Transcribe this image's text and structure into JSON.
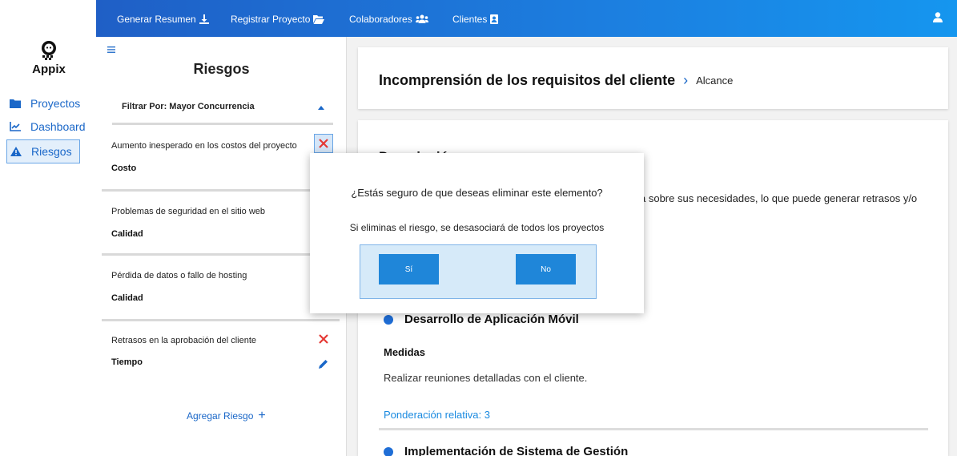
{
  "app": {
    "name": "Appix"
  },
  "sidebar": {
    "items": [
      {
        "label": "Proyectos",
        "icon": "folder-icon"
      },
      {
        "label": "Dashboard",
        "icon": "chart-line-icon"
      },
      {
        "label": "Riesgos",
        "icon": "warning-icon",
        "active": true
      }
    ]
  },
  "topbar": {
    "items": [
      {
        "label": "Generar Resumen",
        "icon": "download-icon"
      },
      {
        "label": "Registrar Proyecto",
        "icon": "folder-open-icon"
      },
      {
        "label": "Colaboradores",
        "icon": "users-icon"
      },
      {
        "label": "Clientes",
        "icon": "address-book-icon"
      }
    ],
    "user_icon": "user-icon"
  },
  "risk_panel": {
    "title": "Riesgos",
    "filter_label": "Filtrar Por: Mayor Concurrencia",
    "items": [
      {
        "name": "Aumento inesperado en los costos del proyecto",
        "category": "Costo"
      },
      {
        "name": "Problemas de seguridad en el sitio web",
        "category": "Calidad"
      },
      {
        "name": "Pérdida de datos o fallo de hosting",
        "category": "Calidad"
      },
      {
        "name": "Retrasos en la aprobación del cliente",
        "category": "Tiempo"
      }
    ],
    "add_label": "Agregar Riesgo",
    "add_icon": "+"
  },
  "detail": {
    "title": "Incomprensión de los requisitos del cliente",
    "breadcrumb": "Alcance",
    "description_heading": "Descripción",
    "description_text": "a sobre sus necesidades, lo que puede generar retrasos y/o",
    "projects": [
      {
        "name": "Desarrollo de Aplicación Móvil",
        "measures_label": "Medidas",
        "measures_text": "Realizar reuniones detalladas con el cliente.",
        "weight_label": "Ponderación relativa: 3"
      },
      {
        "name": "Implementación de Sistema de Gestión"
      }
    ]
  },
  "modal": {
    "question": "¿Estás seguro de que deseas eliminar este elemento?",
    "note": "Si eliminas el riesgo, se desasociará de todos los proyectos",
    "yes_label": "Sí",
    "no_label": "No"
  },
  "colors": {
    "accent": "#1f6ed6",
    "topbar_start": "#1f5fc6",
    "topbar_end": "#1596ef",
    "danger": "#e53935",
    "link": "#1a8ae0"
  }
}
